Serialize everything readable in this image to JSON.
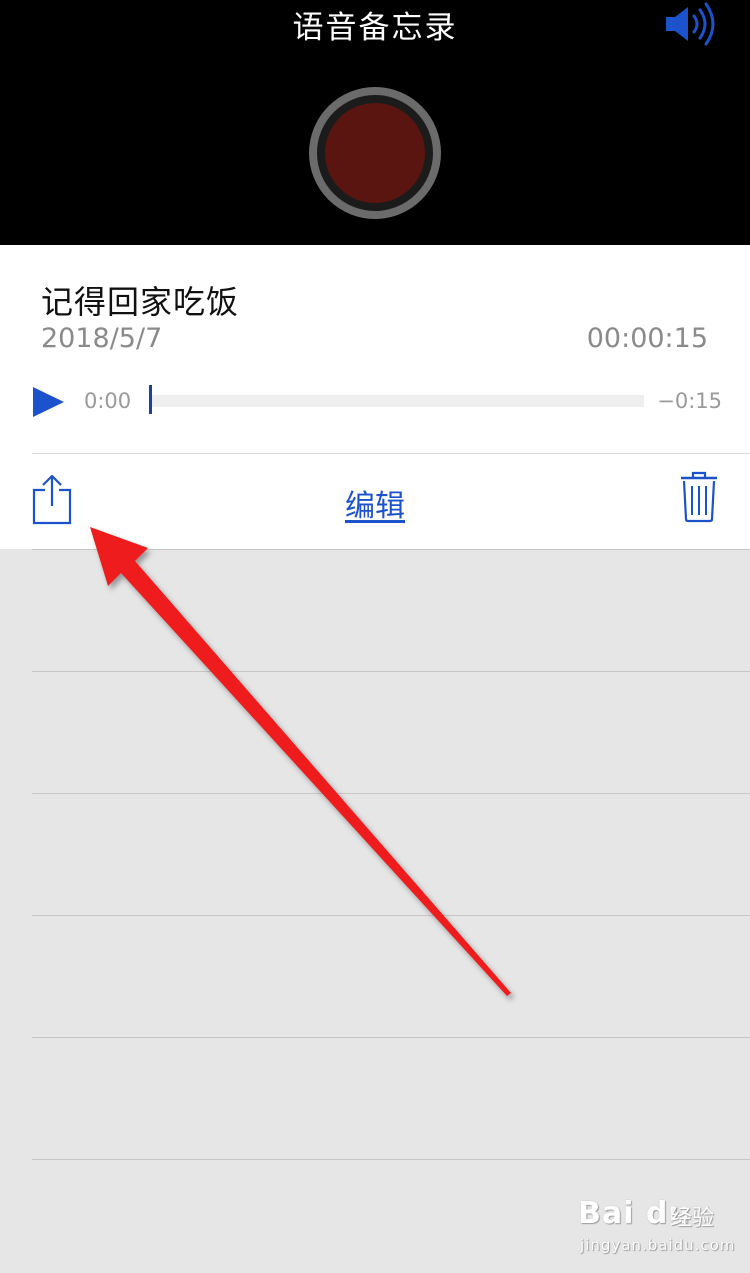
{
  "header": {
    "title": "语音备忘录",
    "volume_icon": "speaker-volume-icon",
    "record_icon": "record-icon",
    "accent_color": "#1c52cc",
    "record_color": "#5a1510"
  },
  "recording": {
    "title": "记得回家吃饭",
    "date": "2018/5/7",
    "duration": "00:00:15",
    "elapsed": "0:00",
    "remaining": "−0:15",
    "progress": 0,
    "play_icon": "play-icon"
  },
  "actions": {
    "share_icon": "share-icon",
    "edit_label": "编辑",
    "trash_icon": "trash-icon"
  },
  "annotation": {
    "arrow_color": "#ee1c1c"
  },
  "watermark": {
    "brand": "Bai du",
    "sub": "经验",
    "url": "jingyan.baidu.com"
  }
}
